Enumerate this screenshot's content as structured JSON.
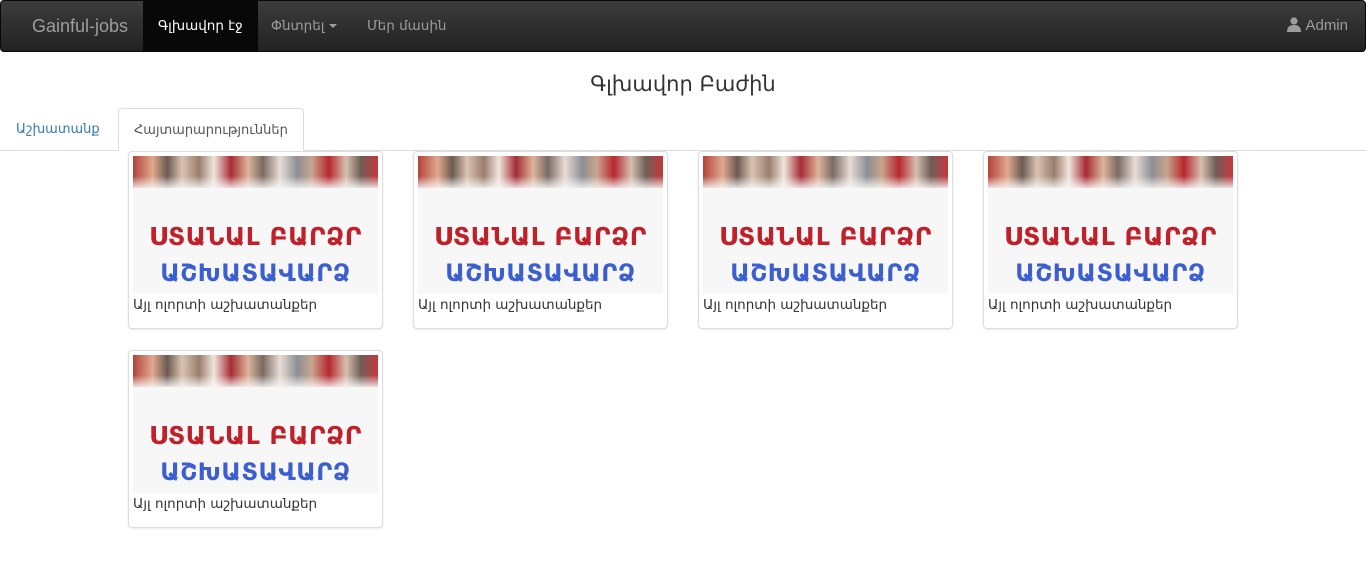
{
  "navbar": {
    "brand": "Gainful-jobs",
    "items": [
      {
        "label": "Գլխավոր էջ",
        "active": true
      },
      {
        "label": "Փնտրել",
        "dropdown": true
      },
      {
        "label": "Մեր մասին"
      }
    ],
    "user": {
      "icon": "user-icon",
      "label": "Admin"
    }
  },
  "page": {
    "title": "Գլխավոր Բաժին"
  },
  "tabs": [
    {
      "label": "Աշխատանք",
      "active": false
    },
    {
      "label": "Հայտարարություններ",
      "active": true
    }
  ],
  "cards": [
    {
      "banner_line1": "ՍՏԱՆԱԼ ԲԱՐՁՐ",
      "banner_line2": "ԱՇԽԱՏԱՎԱՐՁ",
      "caption": "Այլ ոլորտի աշխատանքեր"
    },
    {
      "banner_line1": "ՍՏԱՆԱԼ ԲԱՐՁՐ",
      "banner_line2": "ԱՇԽԱՏԱՎԱՐՁ",
      "caption": "Այլ ոլորտի աշխատանքեր"
    },
    {
      "banner_line1": "ՍՏԱՆԱԼ ԲԱՐՁՐ",
      "banner_line2": "ԱՇԽԱՏԱՎԱՐՁ",
      "caption": "Այլ ոլորտի աշխատանքեր"
    },
    {
      "banner_line1": "ՍՏԱՆԱԼ ԲԱՐՁՐ",
      "banner_line2": "ԱՇԽԱՏԱՎԱՐՁ",
      "caption": "Այլ ոլորտի աշխատանքեր"
    },
    {
      "banner_line1": "ՍՏԱՆԱԼ ԲԱՐՁՐ",
      "banner_line2": "ԱՇԽԱՏԱՎԱՐՁ",
      "caption": "Այլ ոլորտի աշխատանքեր"
    }
  ],
  "colors": {
    "navbar_bg": "#222222",
    "link": "#337ab7",
    "banner_red": "#c0202a",
    "banner_blue": "#3b5fd1"
  }
}
